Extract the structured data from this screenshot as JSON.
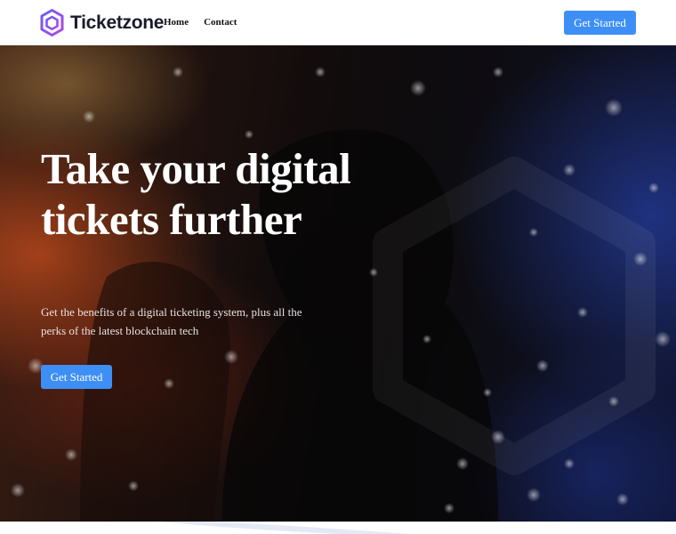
{
  "brand": {
    "name": "Ticketzone",
    "logo_icon": "hexagon-logo-icon",
    "colors": {
      "logo_gradient_start": "#6a5cf5",
      "logo_gradient_end": "#b046e6",
      "logo_text": "#1a1a2e"
    }
  },
  "nav": {
    "links": [
      {
        "label": "Home"
      },
      {
        "label": "Contact"
      }
    ],
    "cta_label": "Get Started"
  },
  "hero": {
    "title": "Take your digital tickets further",
    "subtitle": "Get the benefits of a digital ticketing system, plus all the perks of the latest blockchain tech",
    "cta_label": "Get Started"
  },
  "colors": {
    "accent": "#3d8ff5",
    "hero_warm": "#b9481c",
    "hero_cool": "#243a96"
  }
}
